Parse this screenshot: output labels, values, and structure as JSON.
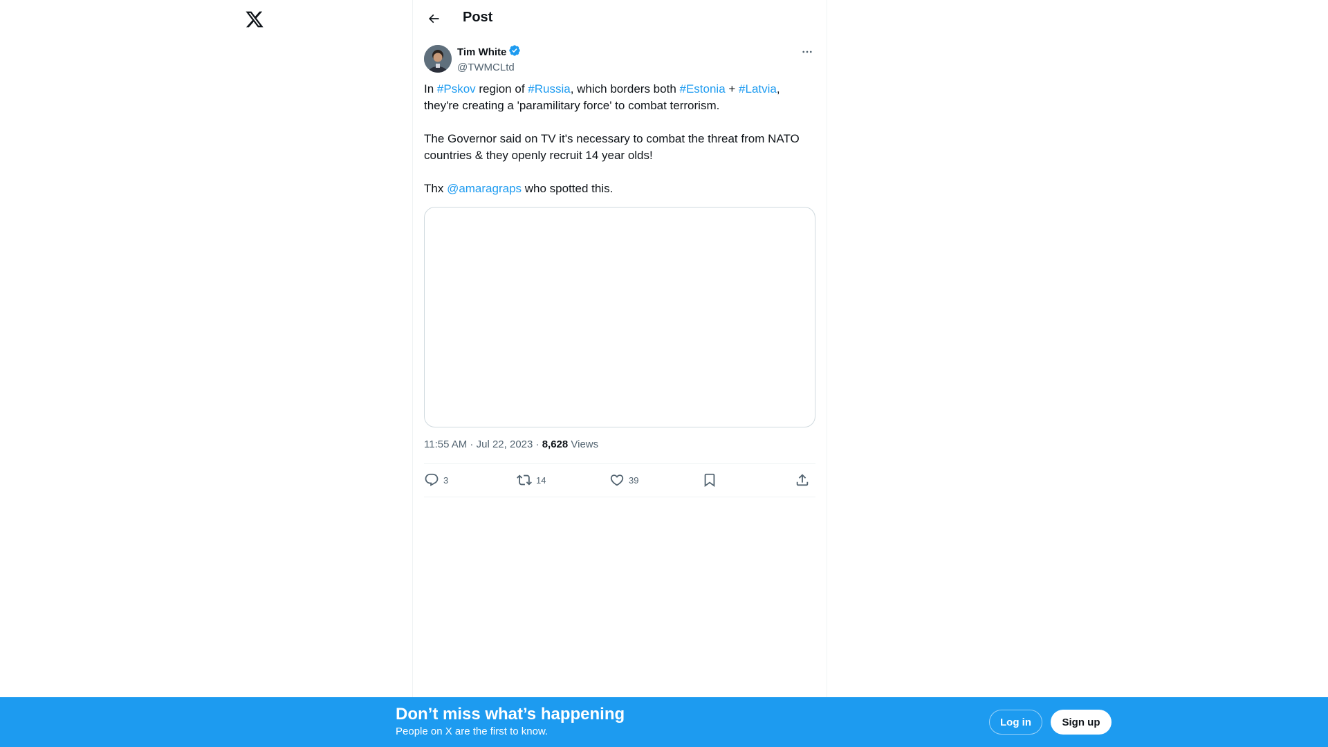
{
  "header": {
    "title": "Post"
  },
  "post": {
    "author": {
      "name": "Tim White",
      "handle": "@TWMCLtd",
      "verified": true
    },
    "text": {
      "p1": {
        "t1": "In ",
        "tag1": "#Pskov",
        "t2": " region of ",
        "tag2": "#Russia",
        "t3": ", which borders both ",
        "tag3": "#Estonia",
        "t4": " + ",
        "tag4": "#Latvia",
        "t5": ", they're creating a 'paramilitary force' to combat terrorism."
      },
      "p2": "The Governor said on TV it's necessary to combat the threat from NATO countries & they openly recruit 14 year olds!",
      "p3": {
        "t1": "Thx ",
        "mention": "@amaragraps",
        "t2": " who spotted this."
      }
    },
    "meta": {
      "time": "11:55 AM",
      "sep1": " · ",
      "date": "Jul 22, 2023",
      "sep2": " · ",
      "views_count": "8,628",
      "views_label": " Views"
    },
    "actions": {
      "replies": "3",
      "reposts": "14",
      "likes": "39"
    }
  },
  "banner": {
    "title": "Don’t miss what’s happening",
    "subtitle": "People on X are the first to know.",
    "login_label": "Log in",
    "signup_label": "Sign up"
  },
  "colors": {
    "accent": "#1d9bf0",
    "text": "#0f1419",
    "secondary": "#536471"
  },
  "icons": [
    "x-logo-icon",
    "back-arrow-icon",
    "verified-badge-icon",
    "more-icon",
    "reply-icon",
    "repost-icon",
    "like-icon",
    "bookmark-icon",
    "share-icon"
  ]
}
